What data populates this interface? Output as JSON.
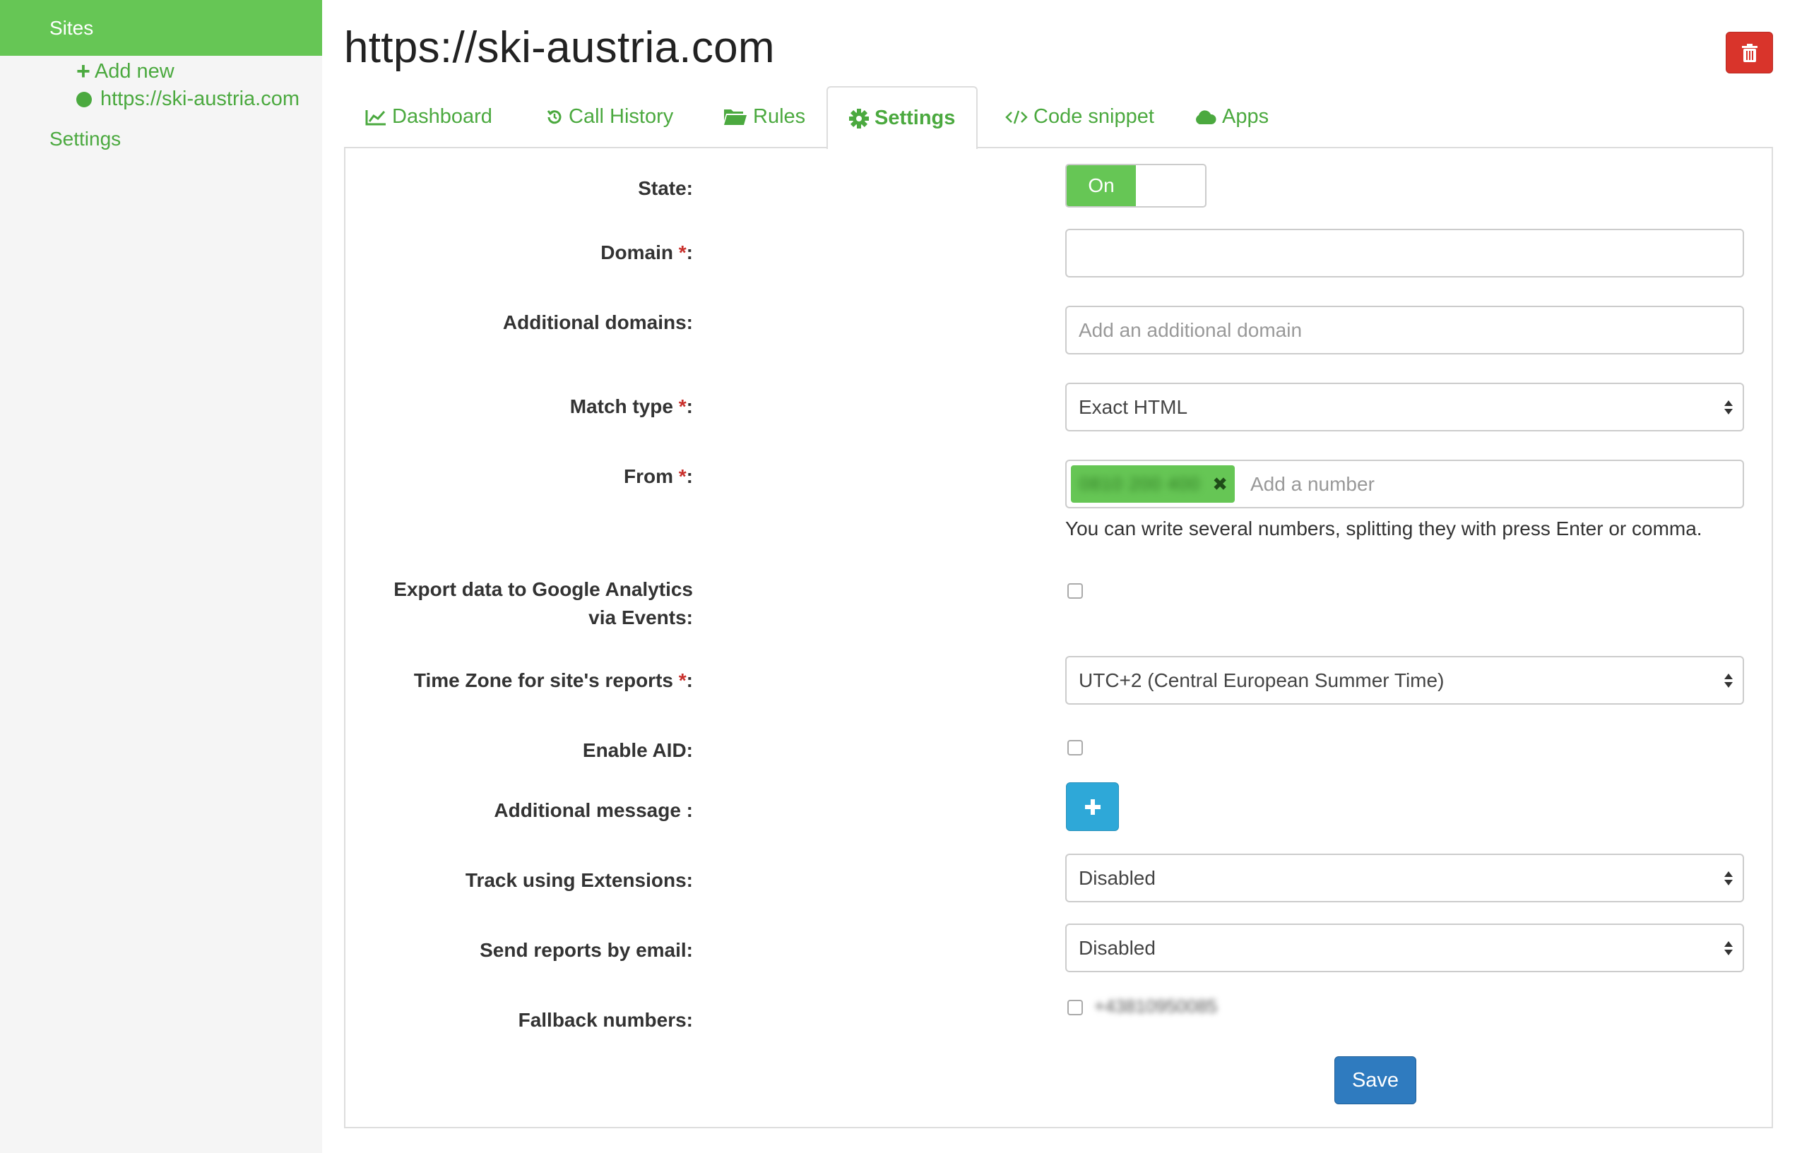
{
  "sidebar": {
    "header": "Sites",
    "add_new": "Add new",
    "site_link": "https://ski-austria.com",
    "settings": "Settings"
  },
  "header": {
    "title": "https://ski-austria.com"
  },
  "tabs": [
    {
      "label": "Dashboard",
      "icon": "line-chart-icon"
    },
    {
      "label": "Call History",
      "icon": "history-icon"
    },
    {
      "label": "Rules",
      "icon": "folder-open-icon"
    },
    {
      "label": "Settings",
      "icon": "gear-icon",
      "active": true
    },
    {
      "label": "Code snippet",
      "icon": "code-icon"
    },
    {
      "label": "Apps",
      "icon": "cloud-icon"
    }
  ],
  "form": {
    "state": {
      "label": "State:",
      "value": "On"
    },
    "domain": {
      "label": "Domain ",
      "required": "*",
      "colon": ":",
      "value": ""
    },
    "additional_domains": {
      "label": "Additional domains:",
      "placeholder": "Add an additional domain"
    },
    "match_type": {
      "label": "Match type ",
      "required": "*",
      "colon": ":",
      "value": "Exact HTML"
    },
    "from": {
      "label": "From ",
      "required": "*",
      "colon": ":",
      "tag": "0810 200 400",
      "placeholder": "Add a number",
      "help": "You can write several numbers, splitting they with press Enter or comma."
    },
    "export_ga": {
      "label_line1": "Export data to Google Analytics",
      "label_line2": "via Events:",
      "checked": false
    },
    "time_zone": {
      "label": "Time Zone for site's reports ",
      "required": "*",
      "colon": ":",
      "value": "UTC+2 (Central European Summer Time)"
    },
    "enable_aid": {
      "label": "Enable AID:",
      "checked": false
    },
    "additional_message": {
      "label": "Additional message :",
      "button": "+"
    },
    "track_extensions": {
      "label": "Track using Extensions:",
      "value": "Disabled"
    },
    "send_reports": {
      "label": "Send reports by email:",
      "value": "Disabled"
    },
    "fallback_numbers": {
      "label": "Fallback numbers:",
      "value": "+43810950085",
      "checked": false
    },
    "save": "Save"
  },
  "colors": {
    "brand_green": "#66c655",
    "link_green": "#4ba93f",
    "danger": "#d9342b",
    "info": "#2ea8d8",
    "primary": "#2f7bbf"
  }
}
